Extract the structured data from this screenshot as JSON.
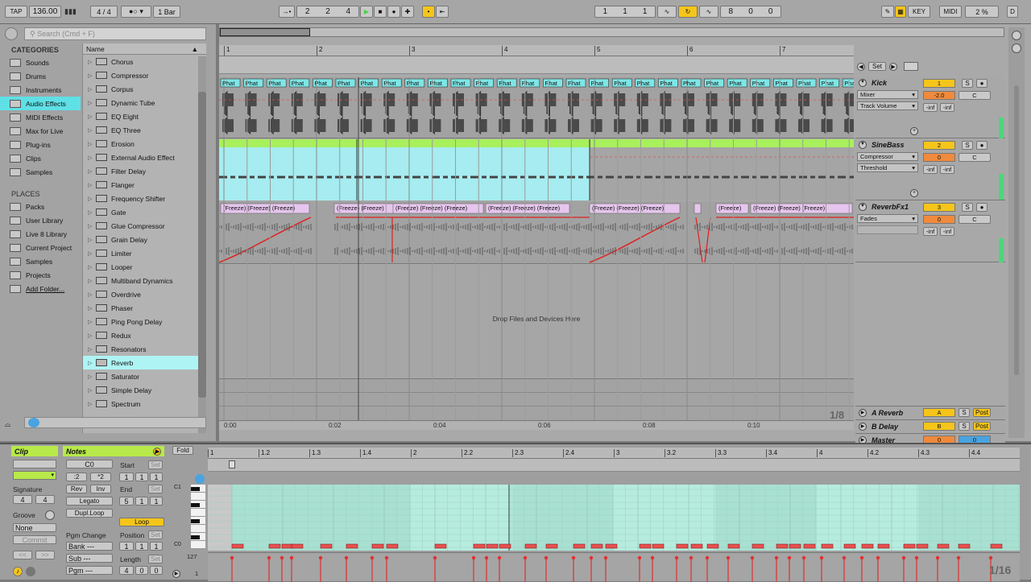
{
  "transport": {
    "tap": "TAP",
    "tempo": "136.00",
    "meter_num": "4",
    "meter_den": "4",
    "metro": "1 Bar",
    "position": [
      "2",
      "2",
      "4"
    ],
    "loop_start": [
      "1",
      "1",
      "1"
    ],
    "loop_len": [
      "8",
      "0",
      "0"
    ],
    "key_label": "KEY",
    "midi_label": "MIDI",
    "cpu": "2 %",
    "d_label": "D"
  },
  "browser": {
    "search_placeholder": "Search (Cmd + F)",
    "categories_title": "CATEGORIES",
    "categories": [
      "Sounds",
      "Drums",
      "Instruments",
      "Audio Effects",
      "MIDI Effects",
      "Max for Live",
      "Plug-ins",
      "Clips",
      "Samples"
    ],
    "places_title": "PLACES",
    "places": [
      "Packs",
      "User Library",
      "Live 8 Library",
      "Current Project",
      "Samples",
      "Projects",
      "Add Folder..."
    ],
    "name_header": "Name",
    "items": [
      "Chorus",
      "Compressor",
      "Corpus",
      "Dynamic Tube",
      "EQ Eight",
      "EQ Three",
      "Erosion",
      "External Audio Effect",
      "Filter Delay",
      "Flanger",
      "Frequency Shifter",
      "Gate",
      "Glue Compressor",
      "Grain Delay",
      "Limiter",
      "Looper",
      "Multiband Dynamics",
      "Overdrive",
      "Phaser",
      "Ping Pong Delay",
      "Redux",
      "Resonators",
      "Reverb",
      "Saturator",
      "Simple Delay",
      "Spectrum"
    ],
    "selected": "Reverb"
  },
  "arrangement": {
    "bar_labels": [
      "1",
      "2",
      "3",
      "4",
      "5",
      "6",
      "7"
    ],
    "time_labels": [
      "0:00",
      "0:02",
      "0:04",
      "0:06",
      "0:08",
      "0:10"
    ],
    "drop_text": "Drop Files and Devices Here",
    "zoom": "1/8",
    "set_label": "Set",
    "kick_clip_label": "Phat",
    "freeze_clips": [
      "(Freeze) (Freeze) (Freeze)",
      "(Freeze) (Freeze)",
      "(Freeze) (Freeze) (Freeze)",
      "(Freeze) (Freeze) (Freeze)",
      "(Freeze) (Freeze) (Freeze)",
      "(Freeze)",
      "(Freeze) (Freeze) (Freeze)"
    ]
  },
  "tracks": [
    {
      "name": "Kick",
      "num": "1",
      "device": "Mixer",
      "param": "Track Volume",
      "vol": "-2.0",
      "pan": "C",
      "send1": "-inf",
      "send2": "-inf"
    },
    {
      "name": "SineBass",
      "num": "2",
      "device": "Compressor",
      "param": "Threshold",
      "vol": "0",
      "pan": "C",
      "send1": "-inf",
      "send2": "-inf"
    },
    {
      "name": "ReverbFx1",
      "num": "3",
      "device": "Fades",
      "param": "",
      "vol": "0",
      "pan": "C",
      "send1": "-inf",
      "send2": "-inf"
    }
  ],
  "returns": [
    {
      "name": "A Reverb",
      "letter": "A",
      "s": "S",
      "post": "Post"
    },
    {
      "name": "B Delay",
      "letter": "B",
      "s": "S",
      "post": "Post"
    },
    {
      "name": "Master",
      "vol": "0",
      "pan": "0"
    }
  ],
  "clip_view": {
    "clip_tab": "Clip",
    "notes_tab": "Notes",
    "signature_label": "Signature",
    "sig_num": "4",
    "sig_den": "4",
    "groove_label": "Groove",
    "groove_value": "None",
    "commit": "Commit",
    "key": "C0",
    "div2": ":2",
    "mul2": "*2",
    "rev": "Rev",
    "inv": "Inv",
    "legato": "Legato",
    "dupl": "Dupl.Loop",
    "pgm_change": "Pgm Change",
    "bank": "Bank ---",
    "sub": "Sub ---",
    "pgm": "Pgm ---",
    "start_label": "Start",
    "end_label": "End",
    "set": "Set",
    "start_pos": [
      "1",
      "1",
      "1"
    ],
    "end_pos": [
      "5",
      "1",
      "1"
    ],
    "loop": "Loop",
    "position_label": "Position",
    "pos": [
      "1",
      "1",
      "1"
    ],
    "length_label": "Length",
    "len": [
      "4",
      "0",
      "0"
    ],
    "fold": "Fold",
    "ruler": [
      "1",
      "1.2",
      "1.3",
      "1.4",
      "2",
      "2.2",
      "2.3",
      "2.4",
      "3",
      "3.2",
      "3.3",
      "3.4",
      "4",
      "4.2",
      "4.3",
      "4.4"
    ],
    "c1": "C1",
    "c0": "C0",
    "vel_max": "127",
    "vel_min": "1",
    "zoom": "1/16"
  },
  "colors": {
    "accent": "#b7e94a",
    "clip_cyan": "#7ee6e6",
    "clip_green": "#a8f05c",
    "track_num": "#f5c51a",
    "piano_bg": "#a8e0d2",
    "note": "#e8504f"
  }
}
